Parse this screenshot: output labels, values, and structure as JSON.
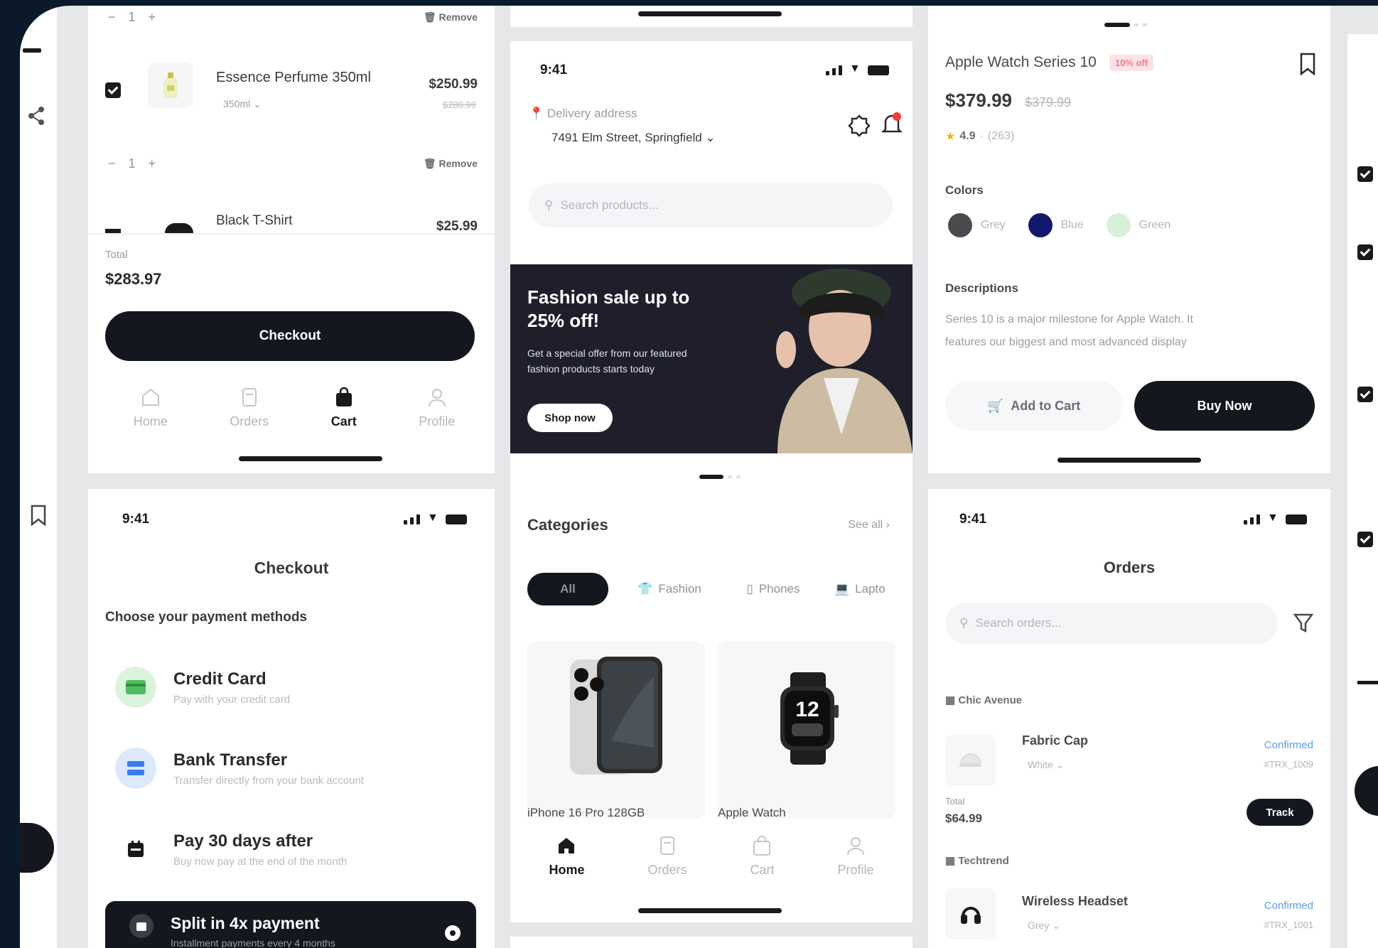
{
  "status_time": "9:41",
  "cart": {
    "stepper_minus": "−",
    "stepper_qty": "1",
    "stepper_plus": "+",
    "remove_label": "Remove",
    "items": [
      {
        "name": "Essence Perfume 350ml",
        "variant": "350ml",
        "price": "$250.99",
        "old_price": "$280.99"
      },
      {
        "name": "Black T-Shirt",
        "price": "$25.99"
      }
    ],
    "total_label": "Total",
    "total_value": "$283.97",
    "checkout_label": "Checkout"
  },
  "nav": {
    "home": "Home",
    "orders": "Orders",
    "cart": "Cart",
    "profile": "Profile"
  },
  "home": {
    "delivery_label": "Delivery address",
    "address": "7491 Elm Street, Springfield",
    "search_placeholder": "Search products...",
    "banner_title_1": "Fashion sale up to",
    "banner_title_2": "25% off!",
    "banner_sub_1": "Get a special offer from our featured",
    "banner_sub_2": "fashion products starts today",
    "banner_button": "Shop now",
    "categories_title": "Categories",
    "see_all": "See all",
    "chips": [
      "All",
      "Fashion",
      "Phones",
      "Lapto"
    ],
    "products": [
      {
        "name": "iPhone 16 Pro 128GB"
      },
      {
        "name": "Apple Watch",
        "watch_time": "12"
      }
    ]
  },
  "product": {
    "title": "Apple Watch Series 10",
    "discount": "10% off",
    "price": "$379.99",
    "old_price": "$379.99",
    "rating": "4.9",
    "reviews": "(263)",
    "colors_label": "Colors",
    "colors": [
      {
        "name": "Grey",
        "hex": "#4a4b4f"
      },
      {
        "name": "Blue",
        "hex": "#12186b"
      },
      {
        "name": "Green",
        "hex": "#d7f1d9"
      }
    ],
    "desc_label": "Descriptions",
    "desc_1": "Series 10 is a major milestone for Apple Watch. It",
    "desc_2": "features our biggest and most advanced display",
    "add_to_cart": "Add to Cart",
    "buy_now": "Buy Now"
  },
  "checkout": {
    "title": "Checkout",
    "subtitle": "Choose your payment methods",
    "methods": [
      {
        "title": "Credit Card",
        "sub": "Pay with your credit card"
      },
      {
        "title": "Bank Transfer",
        "sub": "Transfer directly from your bank account"
      },
      {
        "title": "Pay 30 days after",
        "sub": "Buy now pay at the end of the month"
      },
      {
        "title": "Split in 4x payment",
        "sub": "Installment payments every 4 months"
      }
    ]
  },
  "orders": {
    "title": "Orders",
    "search_placeholder": "Search orders...",
    "groups": [
      {
        "store": "Chic Avenue",
        "item": "Fabric Cap",
        "variant": "White",
        "status": "Confirmed",
        "order_id": "#TRX_1009",
        "total_label": "Total",
        "total": "$64.99",
        "track": "Track"
      },
      {
        "store": "Techtrend",
        "item": "Wireless Headset",
        "variant": "Grey",
        "status": "Confirmed",
        "order_id": "#TRX_1001"
      }
    ]
  }
}
